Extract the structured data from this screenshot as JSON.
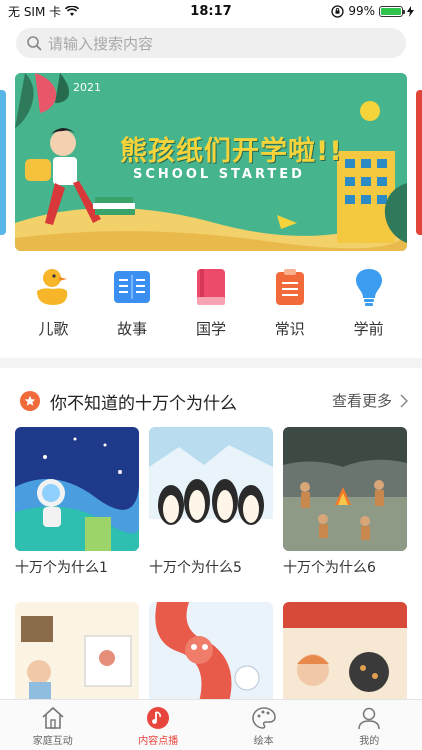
{
  "status": {
    "carrier": "无 SIM 卡",
    "time": "18:17",
    "battery": "99%",
    "battery_level": 0.99
  },
  "search": {
    "placeholder": "请输入搜索内容"
  },
  "banner": {
    "year": "2021",
    "title": "熊孩纸们开学啦!!",
    "subtitle": "SCHOOL STARTED"
  },
  "categories": [
    {
      "label": "儿歌",
      "icon": "duck-icon"
    },
    {
      "label": "故事",
      "icon": "book-icon"
    },
    {
      "label": "国学",
      "icon": "red-book-icon"
    },
    {
      "label": "常识",
      "icon": "clipboard-icon"
    },
    {
      "label": "学前",
      "icon": "lightbulb-icon"
    }
  ],
  "section": {
    "title": "你不知道的十万个为什么",
    "more": "查看更多"
  },
  "cards": [
    {
      "title": "十万个为什么1"
    },
    {
      "title": "十万个为什么5"
    },
    {
      "title": "十万个为什么6"
    }
  ],
  "tabs": [
    {
      "label": "家庭互动",
      "icon": "house-icon",
      "active": false
    },
    {
      "label": "内容点播",
      "icon": "music-note-icon",
      "active": true
    },
    {
      "label": "绘本",
      "icon": "palette-icon",
      "active": false
    },
    {
      "label": "我的",
      "icon": "person-icon",
      "active": false
    }
  ],
  "colors": {
    "accent": "#e8453c",
    "banner_green": "#46b58d",
    "title_yellow": "#f5d33a"
  }
}
